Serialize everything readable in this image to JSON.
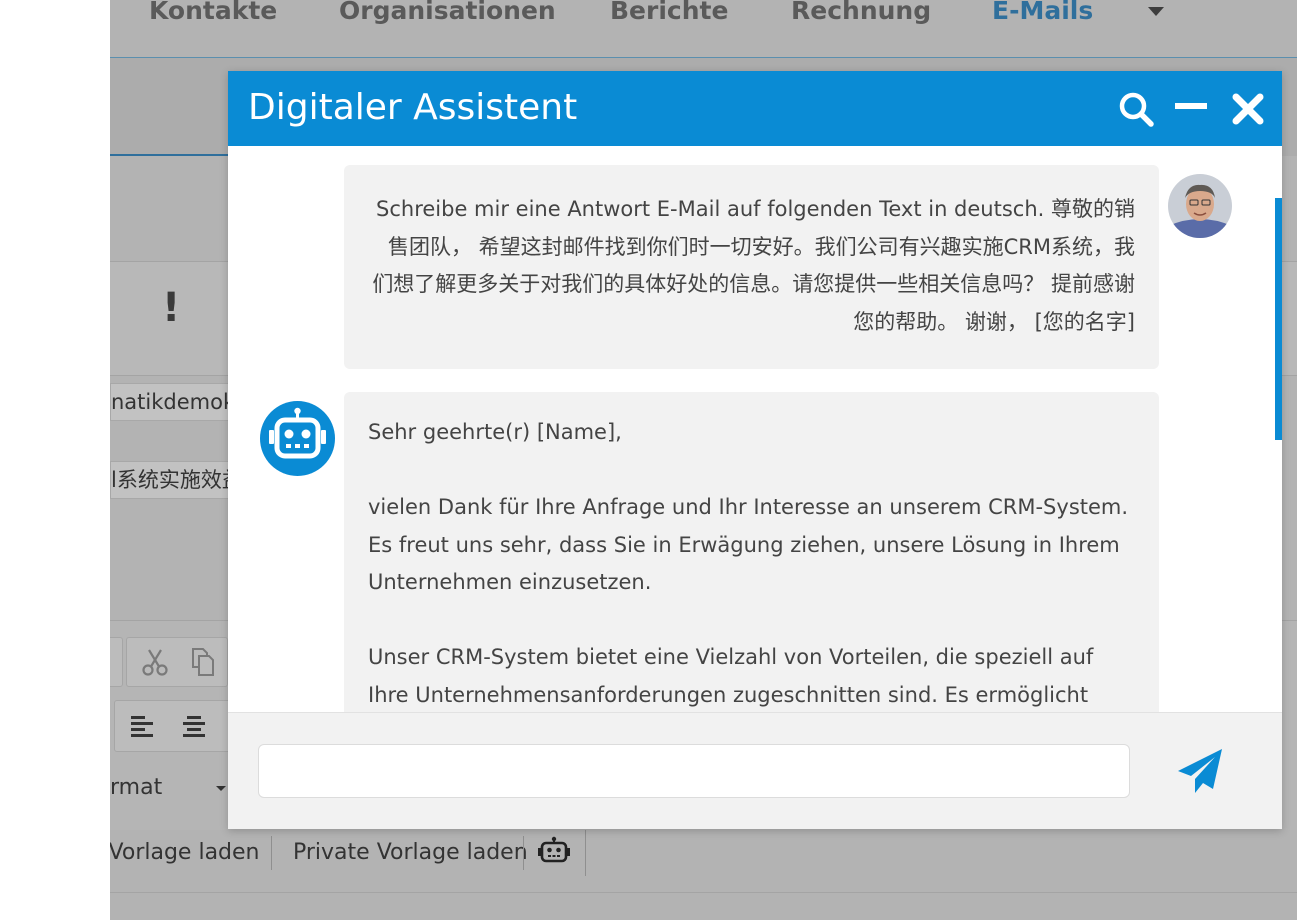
{
  "top_nav": {
    "items": [
      "Kontakte",
      "Organisationen",
      "Berichte",
      "Rechnung",
      "E-Mails"
    ],
    "active": "E-Mails"
  },
  "background_form": {
    "account_field": "natikdemok",
    "subject_field": "l系统实施效益",
    "format_label": "rmat",
    "vorlage_public": "e Vorlage laden",
    "vorlage_private": "Private Vorlage laden"
  },
  "assistant": {
    "title": "Digitaler Assistent",
    "user_message": "Schreibe mir eine Antwort E-Mail auf folgenden Text in deutsch. 尊敬的销售团队， 希望这封邮件找到你们时一切安好。我们公司有兴趣实施CRM系统，我们想了解更多关于对我们的具体好处的信息。请您提供一些相关信息吗？ 提前感谢您的帮助。 谢谢， [您的名字]",
    "bot_message": {
      "greeting": "Sehr geehrte(r) [Name],",
      "paragraph1": "vielen Dank für Ihre Anfrage und Ihr Interesse an unserem CRM-System. Es freut uns sehr, dass Sie in Erwägung ziehen, unsere Lösung in Ihrem Unternehmen einzusetzen.",
      "paragraph2": "Unser CRM-System bietet eine Vielzahl von Vorteilen, die speziell auf Ihre Unternehmensanforderungen zugeschnitten sind. Es ermöglicht Ihnen"
    },
    "input_value": ""
  },
  "colors": {
    "accent": "#0a8bd4",
    "overlay": "#b3b3b3",
    "bubble": "#f2f2f2"
  },
  "icons": [
    "search-icon",
    "minimize-icon",
    "close-icon",
    "send-icon",
    "robot-icon",
    "cut-icon",
    "copy-icon",
    "align-left-icon",
    "align-center-icon",
    "exclamation-icon"
  ]
}
